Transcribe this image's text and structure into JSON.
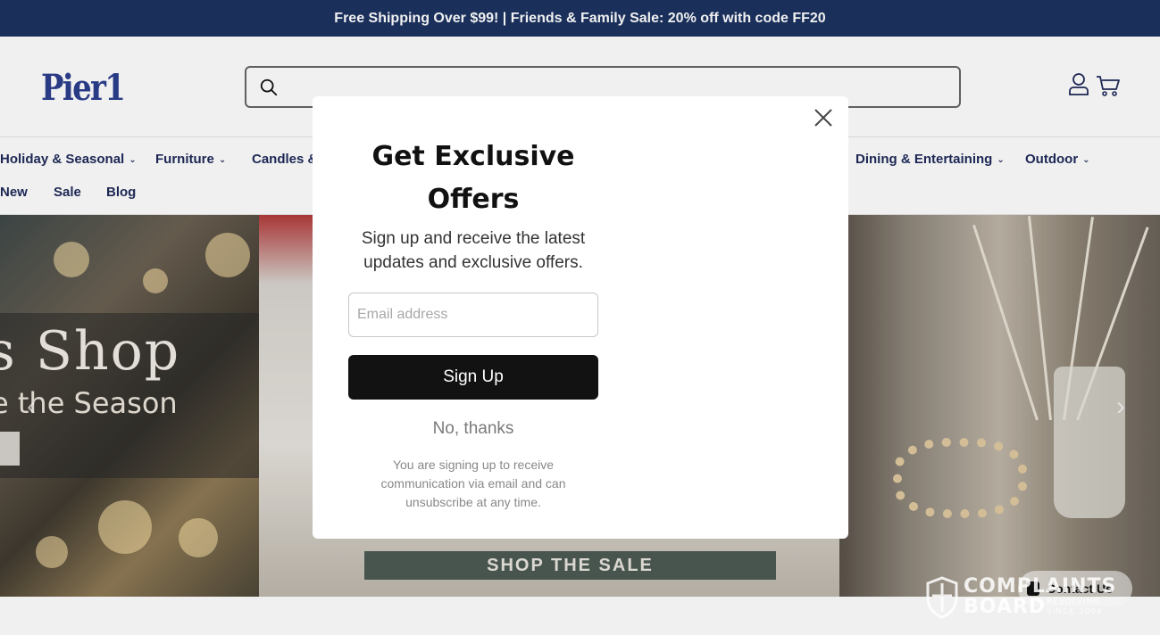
{
  "promo": {
    "text": "Free Shipping Over $99! | Friends & Family Sale: 20% off with code FF20"
  },
  "header": {
    "logo": "Pier1"
  },
  "nav": {
    "items": [
      {
        "label": "Holiday & Seasonal",
        "chevron": true
      },
      {
        "label": "Furniture",
        "chevron": true
      },
      {
        "label": "Candles &",
        "chevron": false
      },
      {
        "label": "Dining & Entertaining",
        "chevron": true
      },
      {
        "label": "Outdoor",
        "chevron": true
      },
      {
        "label": "New",
        "chevron": false
      },
      {
        "label": "Sale",
        "chevron": false
      },
      {
        "label": "Blog",
        "chevron": false
      }
    ]
  },
  "hero": {
    "title": "s Shop",
    "subtitle": "e the Season",
    "cta": "SHOP THE SALE"
  },
  "modal": {
    "title": "Get Exclusive Offers",
    "subtitle": "Sign up and receive the latest updates and exclusive offers.",
    "email_placeholder": "Email address",
    "signup_label": "Sign Up",
    "decline_label": "No, thanks",
    "fine_print": "You are signing up to receive communication via email and can unsubscribe at any time."
  },
  "badge": {
    "name_line1": "COMPLAINTS",
    "name_line2": "BOARD",
    "tagline_line1": "RESOLVING",
    "tagline_line2": "SINCE 2004",
    "contact_label": "Contact Us"
  }
}
